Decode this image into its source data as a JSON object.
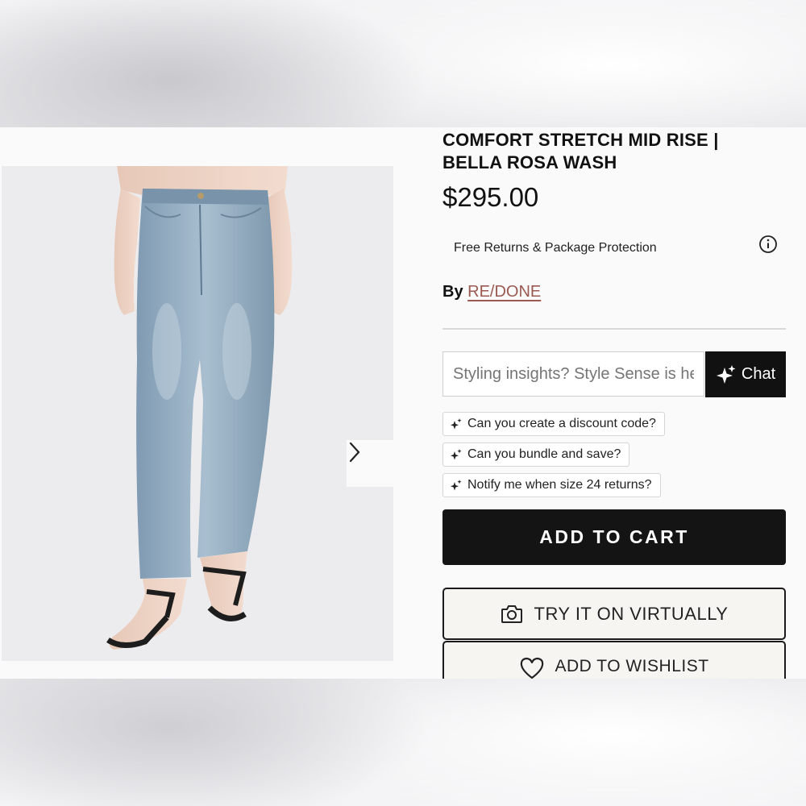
{
  "product": {
    "title_line1": "COMFORT STRETCH MID RISE |",
    "title_line2": "BELLA ROSA WASH",
    "price": "$295.00",
    "returns_text": "Free Returns & Package Protection",
    "by_label": "By",
    "brand": "RE/DONE"
  },
  "gallery": {
    "image_icon": "jeans-product-photo",
    "next_icon": "chevron-right-icon"
  },
  "chat": {
    "placeholder": "Styling insights? Style Sense is here to help",
    "button_label": "Chat",
    "suggestions": [
      "Can you create a discount code?",
      "Can you bundle and save?",
      "Notify me when size 24 returns?"
    ]
  },
  "actions": {
    "add_to_cart": "ADD TO CART",
    "try_on": "TRY IT ON VIRTUALLY",
    "wishlist": "ADD TO WISHLIST"
  },
  "colors": {
    "accent_dark": "#111111",
    "brand_link": "#9a5a52",
    "denim": "#8fa9bf"
  }
}
